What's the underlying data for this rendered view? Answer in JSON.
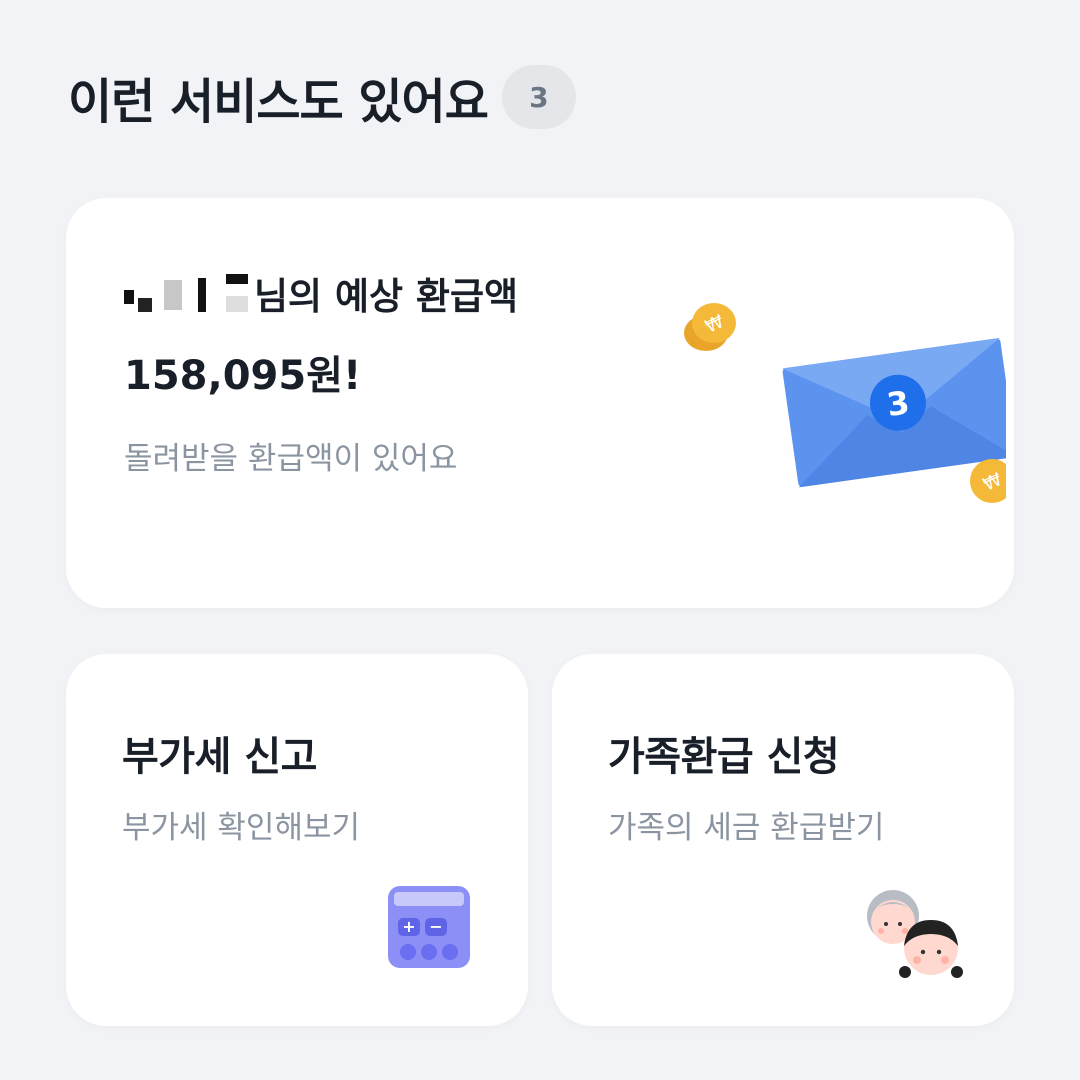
{
  "header": {
    "title": "이런 서비스도 있어요",
    "count": "3"
  },
  "refund_card": {
    "name_suffix": "님의 예상 환급액",
    "amount": "158,095원!",
    "subtitle": "돌려받을 환급액이 있어요",
    "envelope_badge": "3"
  },
  "vat_card": {
    "title": "부가세 신고",
    "subtitle": "부가세 확인해보기"
  },
  "family_card": {
    "title": "가족환급 신청",
    "subtitle": "가족의 세금 환급받기"
  },
  "colors": {
    "background": "#f2f3f6",
    "card": "#ffffff",
    "title_text": "#191f28",
    "sub_text": "#8b95a1",
    "envelope": "#5b93ef",
    "coin": "#f5b93a",
    "calculator": "#8c8ff5"
  },
  "icons": [
    "envelope-icon",
    "coin-icon",
    "calculator-icon",
    "family-icon"
  ]
}
